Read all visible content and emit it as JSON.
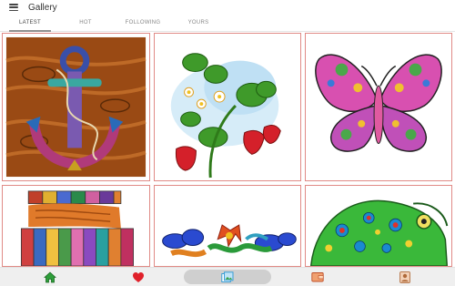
{
  "app": {
    "title": "Gallery"
  },
  "tabs": [
    {
      "label": "LATEST",
      "active": true
    },
    {
      "label": "HOT",
      "active": false
    },
    {
      "label": "FOLLOWING",
      "active": false
    },
    {
      "label": "YOURS",
      "active": false
    }
  ],
  "gallery": {
    "items": [
      {
        "subject": "anchor",
        "icon": "anchor-artwork"
      },
      {
        "subject": "strawberry plant",
        "icon": "strawberry-artwork"
      },
      {
        "subject": "butterfly",
        "icon": "butterfly-artwork"
      },
      {
        "subject": "sleeping girl in patchwork blanket",
        "icon": "girl-blanket-artwork"
      },
      {
        "subject": "dragons and clouds",
        "icon": "dragon-artwork"
      },
      {
        "subject": "chameleon",
        "icon": "chameleon-artwork"
      }
    ]
  },
  "bottom_nav": [
    {
      "icon": "home-icon",
      "color": "#2e9e3a"
    },
    {
      "icon": "heart-icon",
      "color": "#e0202a"
    },
    {
      "icon": "gallery-icon",
      "color": "#3a9fd6"
    },
    {
      "icon": "wallet-icon",
      "color": "#e0704a"
    },
    {
      "icon": "profile-icon",
      "color": "#d98a5a"
    }
  ],
  "colors": {
    "tile_border": "#e08a86",
    "accent_green": "#2e9e3a",
    "accent_red": "#e0202a"
  }
}
